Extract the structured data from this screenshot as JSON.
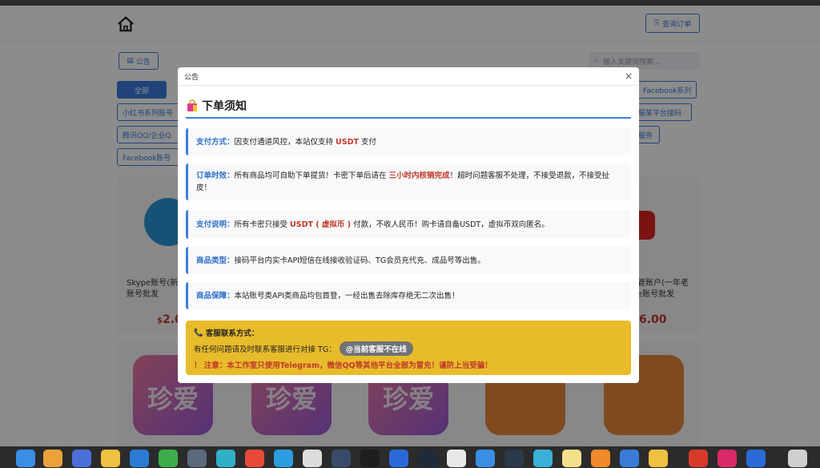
{
  "header": {
    "order_button": "查询订单"
  },
  "toolbar": {
    "notice_button": "公告",
    "search_placeholder": "输入关键词搜索..."
  },
  "categories": [
    {
      "label": "全部"
    },
    {
      "label": "Facebook系列"
    },
    {
      "label": "小红书系列账号"
    },
    {
      "label": "服某平台接码"
    },
    {
      "label": "腾讯QQ/企业Q"
    },
    {
      "label": "服务"
    },
    {
      "label": "Facebook账号"
    }
  ],
  "products": [
    {
      "title_line1": "Skype账号(新",
      "title_line2": "账号批发",
      "price": "2.0"
    },
    {
      "title_line1": "管账户(一年老",
      "title_line2": "e账号批发",
      "price": "6.00"
    }
  ],
  "bottom_icons": [
    {
      "text": "珍爱"
    },
    {
      "text": "珍爱"
    },
    {
      "text": "珍爱"
    }
  ],
  "modal": {
    "header_title": "公告",
    "close_glyph": "×",
    "notice_title": "下单须知",
    "items": [
      {
        "label": "支付方式：",
        "pre": "因支付通道风控，本站仅支持 ",
        "hl": "USDT",
        "post": " 支付"
      },
      {
        "label": "订单时效：",
        "pre": "所有商品均可自助下单提货！卡密下单后请在 ",
        "hl": "三小时内核销完成",
        "post": "！超时问题客服不处理，不接受退款，不接受扯皮！"
      },
      {
        "label": "支付说明：",
        "pre": "所有卡密只接受 ",
        "hl": "USDT ( 虚拟币 )",
        "post": " 付款，不收人民币！购卡请自备USDT，虚拟币双向匿名。"
      },
      {
        "label": "商品类型：",
        "pre": "接码平台内实卡API短信在线接收验证码、TG会员充代充、成品号等出售。",
        "hl": "",
        "post": ""
      },
      {
        "label": "商品保障：",
        "pre": "本站账号类API类商品均包首登，一经出售去除库存绝无二次出售！",
        "hl": "",
        "post": ""
      }
    ],
    "contact": {
      "title": "客服联系方式：",
      "line": "有任何问题请及时联系客服进行对接 TG：",
      "tg": "@当前客服不在线",
      "warning": "！ 注意：本工作室只使用Telegram，微信QQ等其他平台全部为冒充！谨防上当受骗！"
    }
  },
  "colors": {
    "accent": "#3b7ddd",
    "highlight": "#c0392b",
    "contact_bg": "#e8bb2a"
  }
}
